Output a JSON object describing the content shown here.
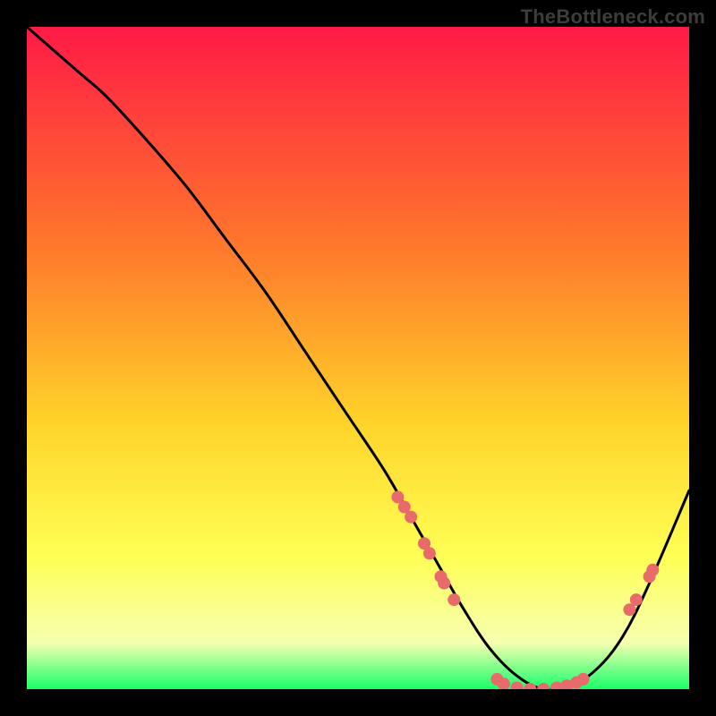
{
  "attribution": "TheBottleneck.com",
  "gradient": {
    "top": "#ff1a46",
    "mid1": "#ff7a2b",
    "mid2": "#ffd42a",
    "mid3": "#ffff55",
    "low": "#f6ffb0",
    "bottom": "#18ff6a"
  },
  "curve_color": "#000000",
  "marker_color": "#e86a6a",
  "chart_data": {
    "type": "line",
    "title": "",
    "xlabel": "",
    "ylabel": "",
    "xlim": [
      0,
      100
    ],
    "ylim": [
      0,
      100
    ],
    "grid": false,
    "series": [
      {
        "name": "curve",
        "x": [
          0,
          4,
          8,
          12,
          18,
          24,
          30,
          36,
          42,
          48,
          54,
          58,
          62,
          66,
          70,
          74,
          78,
          82,
          86,
          90,
          94,
          100
        ],
        "y": [
          100,
          96.5,
          93,
          89.5,
          83,
          76,
          68,
          60,
          51,
          42,
          33,
          26,
          19,
          12,
          6,
          2,
          0,
          0.5,
          3,
          8,
          16,
          30
        ]
      }
    ],
    "markers": [
      {
        "x": 56,
        "y": 29
      },
      {
        "x": 57,
        "y": 27.5
      },
      {
        "x": 58,
        "y": 26
      },
      {
        "x": 60,
        "y": 22
      },
      {
        "x": 60.8,
        "y": 20.5
      },
      {
        "x": 62.5,
        "y": 17
      },
      {
        "x": 63,
        "y": 16
      },
      {
        "x": 64.5,
        "y": 13.5
      },
      {
        "x": 71,
        "y": 1.5
      },
      {
        "x": 72,
        "y": 0.8
      },
      {
        "x": 74,
        "y": 0.2
      },
      {
        "x": 76,
        "y": 0
      },
      {
        "x": 78,
        "y": 0
      },
      {
        "x": 80,
        "y": 0.2
      },
      {
        "x": 81.5,
        "y": 0.5
      },
      {
        "x": 83,
        "y": 1
      },
      {
        "x": 84,
        "y": 1.5
      },
      {
        "x": 91,
        "y": 12
      },
      {
        "x": 92,
        "y": 13.5
      },
      {
        "x": 94,
        "y": 17
      },
      {
        "x": 94.5,
        "y": 18
      }
    ]
  }
}
